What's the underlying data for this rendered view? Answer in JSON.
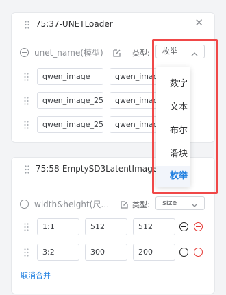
{
  "node1": {
    "title": "75:37-UNETLoader",
    "close_icon": "close-icon",
    "param": {
      "name": "unet_name(模型)",
      "type_label": "类型:",
      "type_value": "枚举"
    },
    "rows": [
      [
        "qwen_image",
        "qwen_image"
      ],
      [
        "qwen_image_25",
        "qwen_image"
      ],
      [
        "qwen_image_25",
        "qwen_image"
      ]
    ]
  },
  "node2": {
    "title": "75:58-EmptySD3LatentImage",
    "param": {
      "name": "width&height(尺…",
      "type_label": "类型:",
      "type_value": "size"
    },
    "rows": [
      [
        "1:1",
        "512",
        "512"
      ],
      [
        "3:2",
        "300",
        "200"
      ]
    ],
    "unmerge_label": "取消合并"
  },
  "type_dropdown": {
    "options": [
      "数字",
      "文本",
      "布尔",
      "滑块",
      "枚举"
    ],
    "selected": "枚举"
  },
  "colors": {
    "accent": "#1f7fe0",
    "highlight": "#f04848",
    "remove": "#e53935"
  }
}
